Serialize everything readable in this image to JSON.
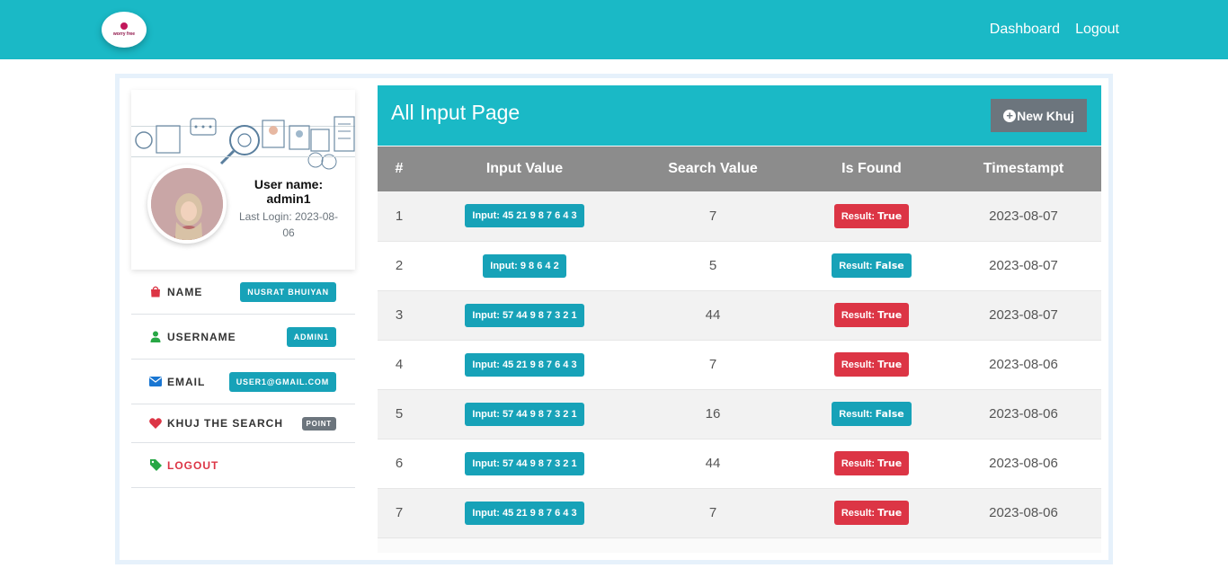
{
  "navbar": {
    "logo_text": "worry free",
    "links": [
      "Dashboard",
      "Logout"
    ]
  },
  "profile": {
    "user_name_label": "User name:",
    "user_name": "admin1",
    "last_login": "Last Login: 2023-08-06",
    "rows": [
      {
        "label": "NAME",
        "value": "NUSRAT BHUIYAN",
        "icon": "shopping-bag-icon"
      },
      {
        "label": "USERNAME",
        "value": "ADMIN1",
        "icon": "user-icon"
      },
      {
        "label": "EMAIL",
        "value": "USER1@GMAIL.COM",
        "icon": "envelope-icon"
      },
      {
        "label": "KHUJ THE SEARCH",
        "value": "POINT",
        "icon": "heart-icon"
      },
      {
        "label": "LOGOUT",
        "icon": "tag-icon"
      }
    ]
  },
  "panel": {
    "title": "All Input Page",
    "new_button": "New Khuj",
    "columns": [
      "#",
      "Input Value",
      "Search Value",
      "Is Found",
      "Timestampt"
    ],
    "rows": [
      {
        "id": "1",
        "input": "Input: 45 21 9 8 7 6 4 3",
        "search": "7",
        "result_label": "Result:",
        "result": "True",
        "timestamp": "2023-08-07"
      },
      {
        "id": "2",
        "input": "Input: 9 8 6 4 2",
        "search": "5",
        "result_label": "Result:",
        "result": "False",
        "timestamp": "2023-08-07"
      },
      {
        "id": "3",
        "input": "Input: 57 44 9 8 7 3 2 1",
        "search": "44",
        "result_label": "Result:",
        "result": "True",
        "timestamp": "2023-08-07"
      },
      {
        "id": "4",
        "input": "Input: 45 21 9 8 7 6 4 3",
        "search": "7",
        "result_label": "Result:",
        "result": "True",
        "timestamp": "2023-08-06"
      },
      {
        "id": "5",
        "input": "Input: 57 44 9 8 7 3 2 1",
        "search": "16",
        "result_label": "Result:",
        "result": "False",
        "timestamp": "2023-08-06"
      },
      {
        "id": "6",
        "input": "Input: 57 44 9 8 7 3 2 1",
        "search": "44",
        "result_label": "Result:",
        "result": "True",
        "timestamp": "2023-08-06"
      },
      {
        "id": "7",
        "input": "Input: 45 21 9 8 7 6 4 3",
        "search": "7",
        "result_label": "Result:",
        "result": "True",
        "timestamp": "2023-08-06"
      }
    ]
  },
  "colors": {
    "primary": "#1ab9c6",
    "info": "#17a2b8",
    "danger": "#dc3545",
    "secondary": "#6c757d",
    "table_header": "#8c8c8c"
  }
}
